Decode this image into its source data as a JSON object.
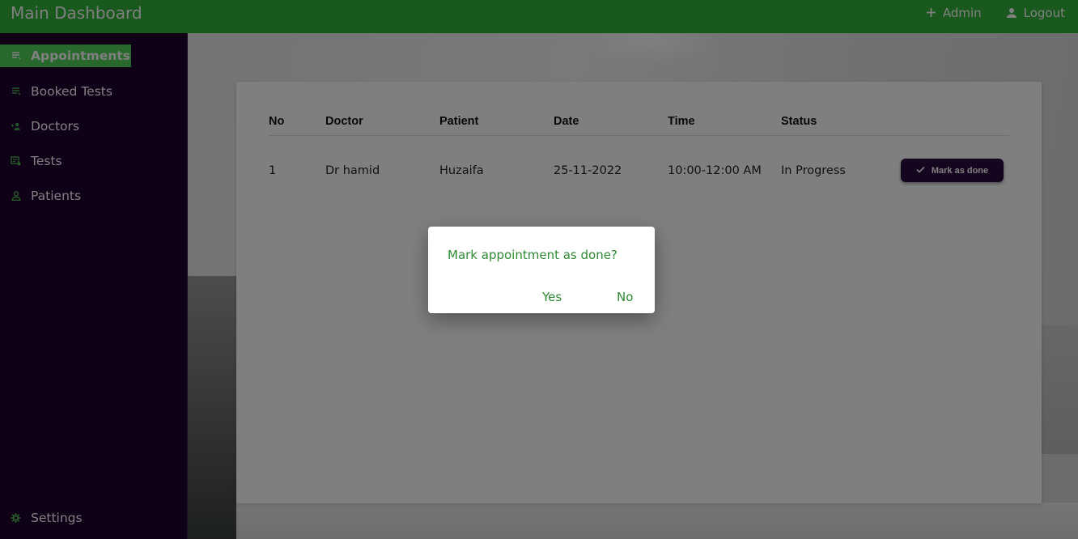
{
  "header": {
    "title": "Main Dashboard",
    "actions": [
      {
        "label": "Admin",
        "icon": "plus-icon"
      },
      {
        "label": "Logout",
        "icon": "person-icon"
      }
    ]
  },
  "sidebar": {
    "items": [
      {
        "label": "Appointments",
        "icon": "list-icon",
        "active": true
      },
      {
        "label": "Booked Tests",
        "icon": "list-icon"
      },
      {
        "label": "Doctors",
        "icon": "add-person-icon"
      },
      {
        "label": "Tests",
        "icon": "test-icon"
      },
      {
        "label": "Patients",
        "icon": "person-icon"
      }
    ],
    "footer": {
      "label": "Settings",
      "icon": "gear-icon"
    }
  },
  "table": {
    "columns": [
      "No",
      "Doctor",
      "Patient",
      "Date",
      "Time",
      "Status"
    ],
    "rows": [
      {
        "no": "1",
        "doctor": "Dr hamid",
        "patient": "Huzaifa",
        "date": "25-11-2022",
        "time": "10:00-12:00 AM",
        "status": "In Progress",
        "action": "Mark as done"
      }
    ]
  },
  "dialog": {
    "message": "Mark appointment as done?",
    "confirm": "Yes",
    "cancel": "No"
  },
  "colors": {
    "topbar": "#34b33a",
    "sidebar": "#1f0030",
    "active_item": "#52d15a",
    "button": "#2a0a3f",
    "dialog_text": "#2f8a35"
  }
}
